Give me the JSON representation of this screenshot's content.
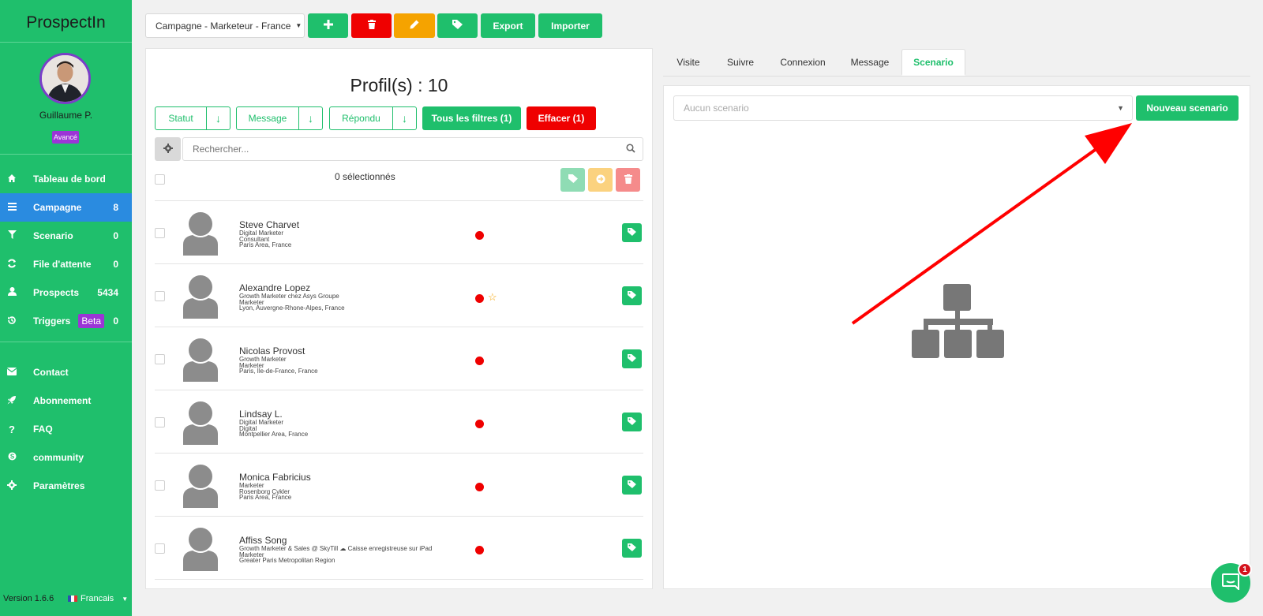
{
  "app": {
    "brand": "ProspectIn",
    "version": "Version 1.6.6",
    "language": "Francais"
  },
  "user": {
    "name": "Guillaume P.",
    "plan_badge": "Avancé"
  },
  "nav": {
    "items": [
      {
        "label": "Tableau de bord",
        "count": "",
        "icon": "home-icon"
      },
      {
        "label": "Campagne",
        "count": "8",
        "icon": "list-icon"
      },
      {
        "label": "Scenario",
        "count": "0",
        "icon": "filter-icon"
      },
      {
        "label": "File d'attente",
        "count": "0",
        "icon": "refresh-icon"
      },
      {
        "label": "Prospects",
        "count": "5434",
        "icon": "user-icon"
      },
      {
        "label": "Triggers",
        "count": "0",
        "badge": "Beta",
        "icon": "history-icon"
      }
    ],
    "secondary": [
      {
        "label": "Contact",
        "icon": "envelope-icon"
      },
      {
        "label": "Abonnement",
        "icon": "rocket-icon"
      },
      {
        "label": "FAQ",
        "icon": "question-icon"
      },
      {
        "label": "community",
        "icon": "skype-icon"
      },
      {
        "label": "Paramètres",
        "icon": "gear-icon"
      }
    ]
  },
  "toolbar": {
    "campaign": "Campagne - Marketeur - France",
    "export_label": "Export",
    "import_label": "Importer",
    "colors": {
      "green": "#1fbf6c",
      "red": "#ef0000",
      "orange": "#f5a300"
    }
  },
  "list": {
    "title": "Profil(s) : 10",
    "filters": [
      "Statut",
      "Message",
      "Répondu"
    ],
    "all_filters_label": "Tous les filtres (1)",
    "clear_label": "Effacer (1)",
    "search_placeholder": "Rechercher...",
    "selected_label": "0 sélectionnés",
    "profiles": [
      {
        "name": "Steve Charvet",
        "lines": [
          "Digital Marketer",
          "Consultant",
          "Paris Area, France"
        ],
        "starred": false
      },
      {
        "name": "Alexandre Lopez",
        "lines": [
          "Growth Marketer chez Asys Groupe",
          "Marketer",
          "Lyon, Auvergne-Rhone-Alpes, France"
        ],
        "starred": true
      },
      {
        "name": "Nicolas Provost",
        "lines": [
          "Growth Marketer",
          "Marketer",
          "Paris, Ile-de-France, France"
        ],
        "starred": false
      },
      {
        "name": "Lindsay L.",
        "lines": [
          "Digital Marketer",
          "Digital",
          "Montpellier Area, France"
        ],
        "starred": false
      },
      {
        "name": "Monica Fabricius",
        "lines": [
          "Marketer",
          "Rosenborg Cykler",
          "Paris Area, France"
        ],
        "starred": false
      },
      {
        "name": "Affiss Song",
        "lines": [
          "Growth Marketer & Sales @ SkyTill ☁ Caisse enregistreuse sur iPad",
          "Marketer",
          "Greater Paris Metropolitan Region"
        ],
        "starred": false
      }
    ]
  },
  "tabs": [
    "Visite",
    "Suivre",
    "Connexion",
    "Message",
    "Scenario"
  ],
  "scenario": {
    "select_placeholder": "Aucun scenario",
    "new_label": "Nouveau scenario"
  },
  "chat": {
    "unread": "1"
  }
}
